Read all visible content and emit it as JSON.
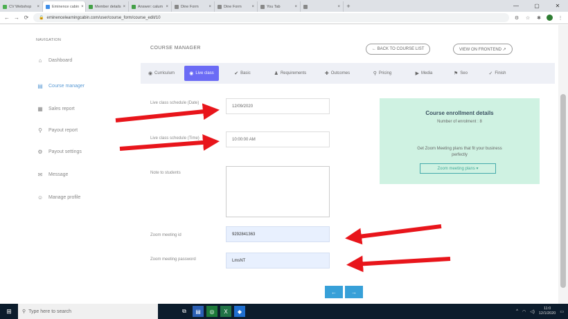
{
  "browser": {
    "tabs": [
      {
        "label": "CV Webshop",
        "color": "#4caf50",
        "active": false
      },
      {
        "label": "Eminence cabin",
        "color": "#3f8ee8",
        "active": true
      },
      {
        "label": "Member details",
        "color": "#43a047",
        "active": false
      },
      {
        "label": "Answer: calum",
        "color": "#43a047",
        "active": false
      },
      {
        "label": "Dine Form",
        "color": "#888888",
        "active": false
      },
      {
        "label": "Dine Form",
        "color": "#888888",
        "active": false
      },
      {
        "label": "You Tab",
        "color": "#888888",
        "active": false
      },
      {
        "label": "",
        "color": "#888888",
        "active": false
      }
    ],
    "new_tab": "+",
    "url": "eminencelearningcabin.com/user/course_form/course_edit/10",
    "window_controls": [
      "—",
      "▢",
      "✕"
    ]
  },
  "sidebar": {
    "heading": "NAVIGATION",
    "items": [
      {
        "icon": "⌂",
        "label": "Dashboard",
        "active": false
      },
      {
        "icon": "▤",
        "label": "Course manager",
        "active": true
      },
      {
        "icon": "▦",
        "label": "Sales report",
        "active": false
      },
      {
        "icon": "⚲",
        "label": "Payout report",
        "active": false
      },
      {
        "icon": "⚙",
        "label": "Payout settings",
        "active": false
      },
      {
        "icon": "✉",
        "label": "Message",
        "active": false
      },
      {
        "icon": "☺",
        "label": "Manage profile",
        "active": false
      }
    ]
  },
  "main": {
    "title": "COURSE MANAGER",
    "back_button": "← BACK TO COURSE LIST",
    "frontend_button": "VIEW ON FRONTEND ↗",
    "tabs": [
      {
        "icon": "◉",
        "label": "Curriculum",
        "active": false
      },
      {
        "icon": "◉",
        "label": "Live class",
        "active": true
      },
      {
        "icon": "✔",
        "label": "Basic",
        "active": false
      },
      {
        "icon": "♟",
        "label": "Requirements",
        "active": false
      },
      {
        "icon": "✚",
        "label": "Outcomes",
        "active": false
      },
      {
        "icon": "⚲",
        "label": "Pricing",
        "active": false
      },
      {
        "icon": "▶",
        "label": "Media",
        "active": false
      },
      {
        "icon": "⚑",
        "label": "Seo",
        "active": false
      },
      {
        "icon": "✓",
        "label": "Finish",
        "active": false
      }
    ],
    "form": {
      "date_label": "Live class schedule (Date)",
      "date_value": "12/09/2020",
      "time_label": "Live class schedule (Time)",
      "time_value": "10:00:00 AM",
      "note_label": "Note to students",
      "zoom_id_label": "Zoom meeting id",
      "zoom_id_value": "9292841363",
      "zoom_pwd_label": "Zoom meeting password",
      "zoom_pwd_value": "LmsNT"
    },
    "enrollment": {
      "title": "Course enrollment details",
      "count_text": "Number of enrolment : 8",
      "description": "Get Zoom Meeting plans that fit your business perfectly",
      "button": "Zoom meeting plans ▾"
    },
    "nav_buttons": [
      "←",
      "→"
    ]
  },
  "taskbar": {
    "search_placeholder": "Type here to search",
    "time": "11:0",
    "date": "12/1/2020"
  }
}
